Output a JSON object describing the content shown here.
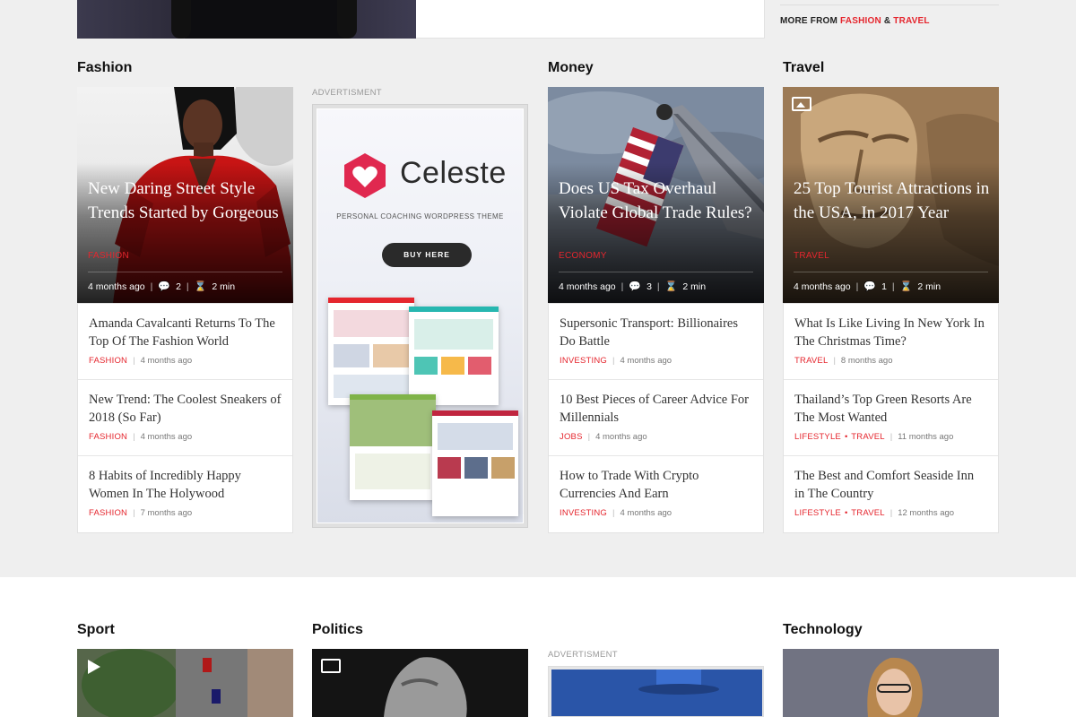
{
  "top": {
    "more_from_prefix": "MORE FROM",
    "more_from_cat1": "FASHION",
    "more_from_amp": "&",
    "more_from_cat2": "TRAVEL"
  },
  "sections": {
    "fashion": "Fashion",
    "money": "Money",
    "travel": "Travel",
    "sport": "Sport",
    "politics": "Politics",
    "technology": "Technology"
  },
  "ad": {
    "label": "ADVERTISMENT",
    "brand": "Celeste",
    "subtitle": "PERSONAL COACHING WORDPRESS THEME",
    "button": "BUY HERE",
    "label2": "ADVERTISMENT"
  },
  "fashion": {
    "hero": {
      "title": "New Daring Street Style Trends Started by Gorgeous",
      "category": "FASHION",
      "time": "4 months ago",
      "comments": "2",
      "read": "2 min"
    },
    "items": [
      {
        "title": "Amanda Cavalcanti Returns To The Top Of The Fashion World",
        "cat": "FASHION",
        "time": "4 months ago"
      },
      {
        "title": "New Trend: The Coolest Sneakers of 2018 (So Far)",
        "cat": "FASHION",
        "time": "4 months ago"
      },
      {
        "title": "8 Habits of Incredibly Happy Women In The Holywood",
        "cat": "FASHION",
        "time": "7 months ago"
      }
    ]
  },
  "money": {
    "hero": {
      "title": "Does US Tax Overhaul Violate Global Trade Rules?",
      "category": "ECONOMY",
      "time": "4 months ago",
      "comments": "3",
      "read": "2 min"
    },
    "items": [
      {
        "title": "Supersonic Transport: Billionaires Do Battle",
        "cat": "INVESTING",
        "time": "4 months ago"
      },
      {
        "title": "10 Best Pieces of Career Advice For Millennials",
        "cat": "JOBS",
        "time": "4 months ago"
      },
      {
        "title": "How to Trade With Crypto Currencies And Earn",
        "cat": "INVESTING",
        "time": "4 months ago"
      }
    ]
  },
  "travel": {
    "hero": {
      "title": "25 Top Tourist Attractions in the USA, In 2017 Year",
      "category": "TRAVEL",
      "time": "4 months ago",
      "comments": "1",
      "read": "2 min"
    },
    "items": [
      {
        "title": "What Is Like Living In New York In The Christmas Time?",
        "cat": "TRAVEL",
        "cat2": "",
        "time": "8 months ago"
      },
      {
        "title": "Thailand’s Top Green Resorts Are The Most Wanted",
        "cat": "LIFESTYLE",
        "cat2": "TRAVEL",
        "time": "11 months ago"
      },
      {
        "title": "The Best and Comfort Seaside Inn in The Country",
        "cat": "LIFESTYLE",
        "cat2": "TRAVEL",
        "time": "12 months ago"
      }
    ]
  },
  "colors": {
    "accent": "#e5262e",
    "background": "#efefef"
  }
}
